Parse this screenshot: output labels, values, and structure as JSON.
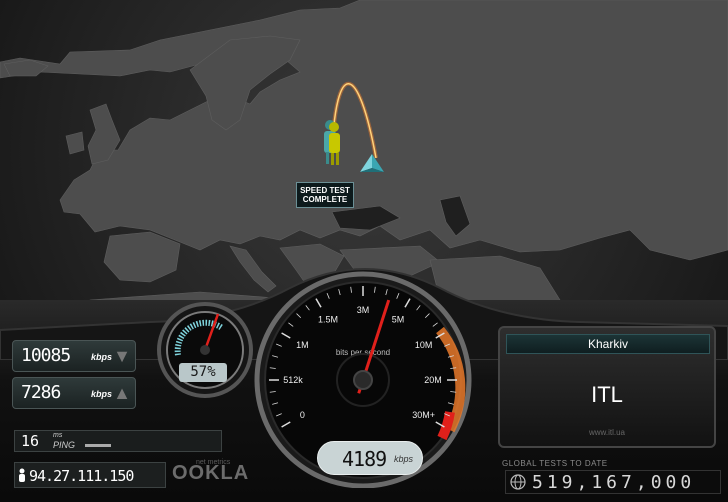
{
  "map": {
    "status_line1": "SPEED TEST",
    "status_line2": "COMPLETE"
  },
  "results": {
    "download_value": "10085",
    "download_unit": "kbps",
    "upload_value": "7286",
    "upload_unit": "kbps",
    "ping_value": "16",
    "ping_ms_label": "ms",
    "ping_label": "PING",
    "ip": "94.27.111.150"
  },
  "branding": {
    "logo": "OOKLA",
    "tagline": "net metrics"
  },
  "small_gauge": {
    "percent_label": "57%",
    "percent": 0.57
  },
  "speedometer": {
    "tick_labels": [
      "0",
      "512k",
      "1M",
      "1.5M",
      "3M",
      "5M",
      "10M",
      "20M",
      "30M+"
    ],
    "unit_caption": "bits per second",
    "reading_value": "4189",
    "reading_unit": "kbps",
    "needle_kbps": 4189
  },
  "server": {
    "city": "Kharkiv",
    "isp": "ITL",
    "url": "www.itl.ua"
  },
  "global": {
    "label": "GLOBAL TESTS TO DATE",
    "count": "519,167,000"
  },
  "colors": {
    "accent_orange": "#e8792a",
    "needle_red": "#e0201b",
    "gauge_face": "#0b0b0b"
  }
}
